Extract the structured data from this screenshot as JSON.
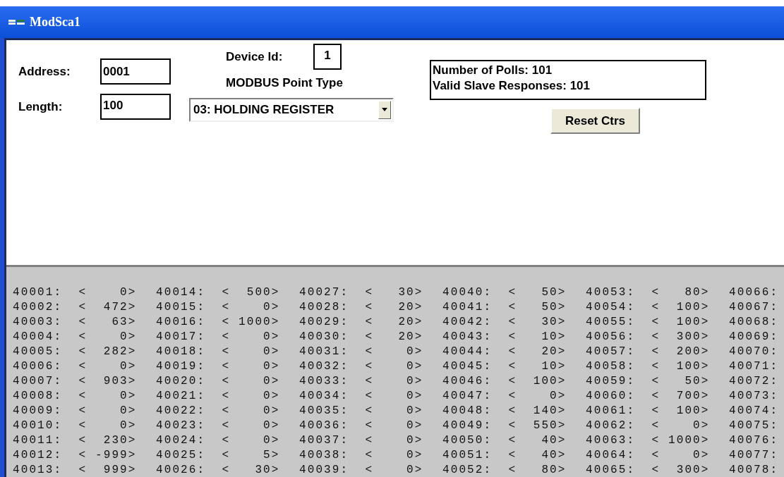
{
  "window": {
    "title": "ModSca1"
  },
  "form": {
    "address": {
      "label": "Address:",
      "value": "0001"
    },
    "length": {
      "label": "Length:",
      "value": "100"
    },
    "device_id": {
      "label": "Device Id:",
      "value": "1"
    },
    "point_type": {
      "label": "MODBUS Point Type",
      "value": "03: HOLDING REGISTER"
    },
    "counters": [
      "Number of Polls: 101",
      "Valid Slave Responses: 101"
    ],
    "reset_button": "Reset Ctrs"
  },
  "registers": [
    [
      "40001:  <    0>",
      "40002:  <  472>",
      "40003:  <   63>",
      "40004:  <    0>",
      "40005:  <  282>",
      "40006:  <    0>",
      "40007:  <  903>",
      "40008:  <    0>",
      "40009:  <    0>",
      "40010:  <    0>",
      "40011:  <  230>",
      "40012:  < -999>",
      "40013:  <  999>"
    ],
    [
      "40014:  <  500>",
      "40015:  <    0>",
      "40016:  < 1000>",
      "40017:  <    0>",
      "40018:  <    0>",
      "40019:  <    0>",
      "40020:  <    0>",
      "40021:  <    0>",
      "40022:  <    0>",
      "40023:  <    0>",
      "40024:  <    0>",
      "40025:  <    5>",
      "40026:  <   30>"
    ],
    [
      "40027:  <   30>",
      "40028:  <   20>",
      "40029:  <   20>",
      "40030:  <   20>",
      "40031:  <    0>",
      "40032:  <    0>",
      "40033:  <    0>",
      "40034:  <    0>",
      "40035:  <    0>",
      "40036:  <    0>",
      "40037:  <    0>",
      "40038:  <    0>",
      "40039:  <    0>"
    ],
    [
      "40040:  <   50>",
      "40041:  <   50>",
      "40042:  <   30>",
      "40043:  <   10>",
      "40044:  <   20>",
      "40045:  <   10>",
      "40046:  <  100>",
      "40047:  <    0>",
      "40048:  <  140>",
      "40049:  <  550>",
      "40050:  <   40>",
      "40051:  <   40>",
      "40052:  <   80>"
    ],
    [
      "40053:  <   80>",
      "40054:  <  100>",
      "40055:  <  100>",
      "40056:  <  300>",
      "40057:  <  200>",
      "40058:  <  100>",
      "40059:  <   50>",
      "40060:  <  700>",
      "40061:  <  100>",
      "40062:  <    0>",
      "40063:  < 1000>",
      "40064:  <    0>",
      "40065:  <  300>"
    ],
    [
      "40066:",
      "40067:",
      "40068:",
      "40069:",
      "40070:",
      "40071:",
      "40072:",
      "40073:",
      "40074:",
      "40075:",
      "40076:",
      "40077:",
      "40078:"
    ]
  ]
}
